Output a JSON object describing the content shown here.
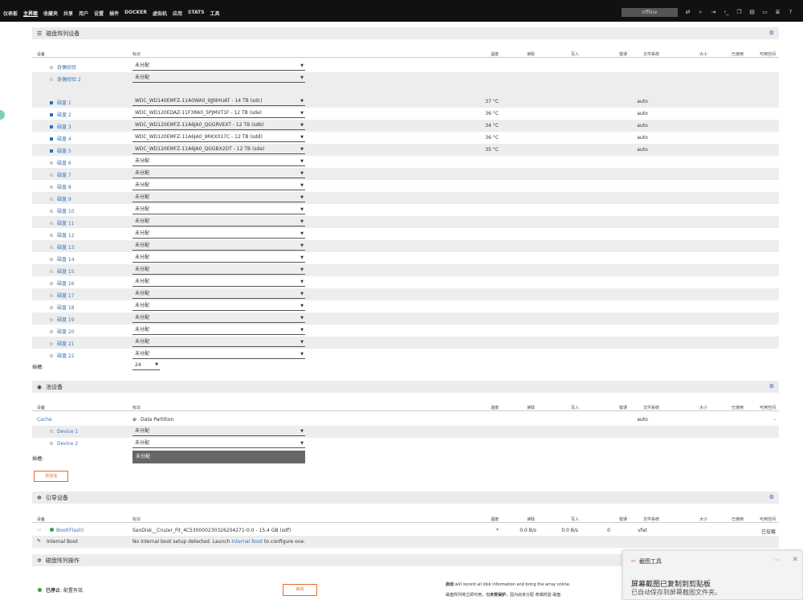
{
  "topbar": {
    "nav": [
      "仪表板",
      "主界面",
      "收藏夹",
      "共享",
      "用户",
      "设置",
      "插件",
      "DOCKER",
      "虚拟机",
      "应用",
      "STATS",
      "工具"
    ],
    "active_index": 1,
    "status": "offline",
    "icons": [
      "transfer-icon",
      "search-icon",
      "logout-icon",
      "terminal-icon",
      "copy-icon",
      "message-icon",
      "monitor-icon",
      "log-icon",
      "help-icon"
    ]
  },
  "array": {
    "title": "磁盘阵列设备",
    "headers": [
      "设备",
      "标识",
      "温度",
      "读取",
      "写入",
      "错误",
      "文件系统",
      "大小",
      "已使用",
      "可用空间"
    ],
    "parity": [
      {
        "name": "奇偶校验",
        "value": "未分配"
      },
      {
        "name": "奇偶校验 2",
        "value": "未分配"
      }
    ],
    "disks": [
      {
        "name": "磁盘 1",
        "value": "WDC_WD140EMFZ-11A0WA0_9JJNHUAT - 14 TB (sdc)",
        "temp": "37 °C",
        "fs": "auto",
        "active": true
      },
      {
        "name": "磁盘 2",
        "value": "WDC_WD120EDAZ-11F3RA0_5PJMVT1F - 12 TB (sde)",
        "temp": "36 °C",
        "fs": "auto",
        "active": true
      },
      {
        "name": "磁盘 3",
        "value": "WDC_WD120EMFZ-11A6JA0_QGGRVEXT - 12 TB (sdb)",
        "temp": "34 °C",
        "fs": "auto",
        "active": true
      },
      {
        "name": "磁盘 4",
        "value": "WDC_WD120EMFZ-11A6JA0_9RKX017C - 12 TB (sdd)",
        "temp": "36 °C",
        "fs": "auto",
        "active": true
      },
      {
        "name": "磁盘 5",
        "value": "WDC_WD120EMFZ-11A6JA0_QGGBX2DT - 12 TB (sda)",
        "temp": "35 °C",
        "fs": "auto",
        "active": true
      },
      {
        "name": "磁盘 6",
        "value": "未分配"
      },
      {
        "name": "磁盘 7",
        "value": "未分配"
      },
      {
        "name": "磁盘 8",
        "value": "未分配"
      },
      {
        "name": "磁盘 9",
        "value": "未分配"
      },
      {
        "name": "磁盘 10",
        "value": "未分配"
      },
      {
        "name": "磁盘 11",
        "value": "未分配"
      },
      {
        "name": "磁盘 12",
        "value": "未分配"
      },
      {
        "name": "磁盘 13",
        "value": "未分配"
      },
      {
        "name": "磁盘 14",
        "value": "未分配"
      },
      {
        "name": "磁盘 15",
        "value": "未分配"
      },
      {
        "name": "磁盘 16",
        "value": "未分配"
      },
      {
        "name": "磁盘 17",
        "value": "未分配"
      },
      {
        "name": "磁盘 18",
        "value": "未分配"
      },
      {
        "name": "磁盘 19",
        "value": "未分配"
      },
      {
        "name": "磁盘 20",
        "value": "未分配"
      },
      {
        "name": "磁盘 21",
        "value": "未分配"
      },
      {
        "name": "磁盘 22",
        "value": "未分配"
      }
    ],
    "slots_label": "插槽:",
    "slots_value": "24"
  },
  "pool": {
    "title": "池设备",
    "cache_name": "Cache",
    "cache_value": "Data Partition",
    "cache_fs": "auto",
    "cache_free": "-",
    "devices": [
      {
        "name": "Device 1",
        "value": "未分配"
      },
      {
        "name": "Device 2",
        "value": "未分配"
      }
    ],
    "slots_label": "插槽:",
    "slots_value": "未分配",
    "add_button": "添加池"
  },
  "boot": {
    "title": "引导设备",
    "device_name": "Boot(Flash)",
    "device_value": "SanDisk__Cruzer_Fit_4C530000230326204271-0:0 - 15.4 GB (sdf)",
    "temp": "*",
    "read": "0.0 B/s",
    "write": "0.0 B/s",
    "errors": "0",
    "fs": "vfat",
    "free": "已挂载",
    "internal_name": "Internal Boot",
    "internal_text_pre": "No internal boot setup detected. Launch ",
    "internal_link": "Internal Boot",
    "internal_text_post": " to configure one."
  },
  "operations": {
    "title": "磁盘阵列操作",
    "state_bold": "已停止",
    "state_rest": ": 配置有效.",
    "start_button": "启动",
    "desc1_bold": "启动",
    "desc1_rest": " will record all disk information and bring the array online.",
    "desc2_pre": "磁盘阵列将立即可用，但",
    "desc2_bold": "未受保护",
    "desc2_post": "，因为尚未分配 奇偶校验 磁盘"
  },
  "toast": {
    "app": "截图工具",
    "line1": "屏幕截图已复制到剪贴板",
    "line2": "已自动保存到屏幕截图文件夹。",
    "more": "···",
    "close": "✕"
  },
  "colors": {
    "accent_blue": "#1e73c8",
    "link_blue": "#3b73b9",
    "orange": "#e8672b",
    "topbar": "#111111",
    "green": "#2ea043"
  }
}
